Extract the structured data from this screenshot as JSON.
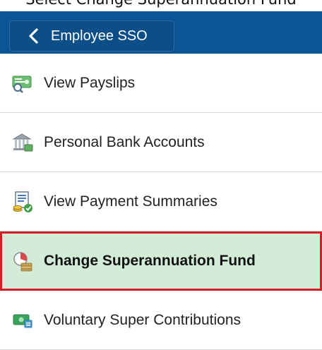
{
  "caption": "Select Change Superannuation Fund",
  "header": {
    "back_label": "Employee SSO"
  },
  "menu": {
    "items": [
      {
        "label": "View Payslips",
        "icon": "payslip-icon"
      },
      {
        "label": "Personal Bank Accounts",
        "icon": "bank-icon"
      },
      {
        "label": "View Payment Summaries",
        "icon": "payment-summary-icon"
      },
      {
        "label": "Change Superannuation Fund",
        "icon": "superannuation-icon",
        "selected": true
      },
      {
        "label": "Voluntary Super Contributions",
        "icon": "contributions-icon"
      }
    ]
  },
  "colors": {
    "header_bg": "#0a5597",
    "selected_bg": "#d3ecd8",
    "selected_border": "#d21f26"
  }
}
